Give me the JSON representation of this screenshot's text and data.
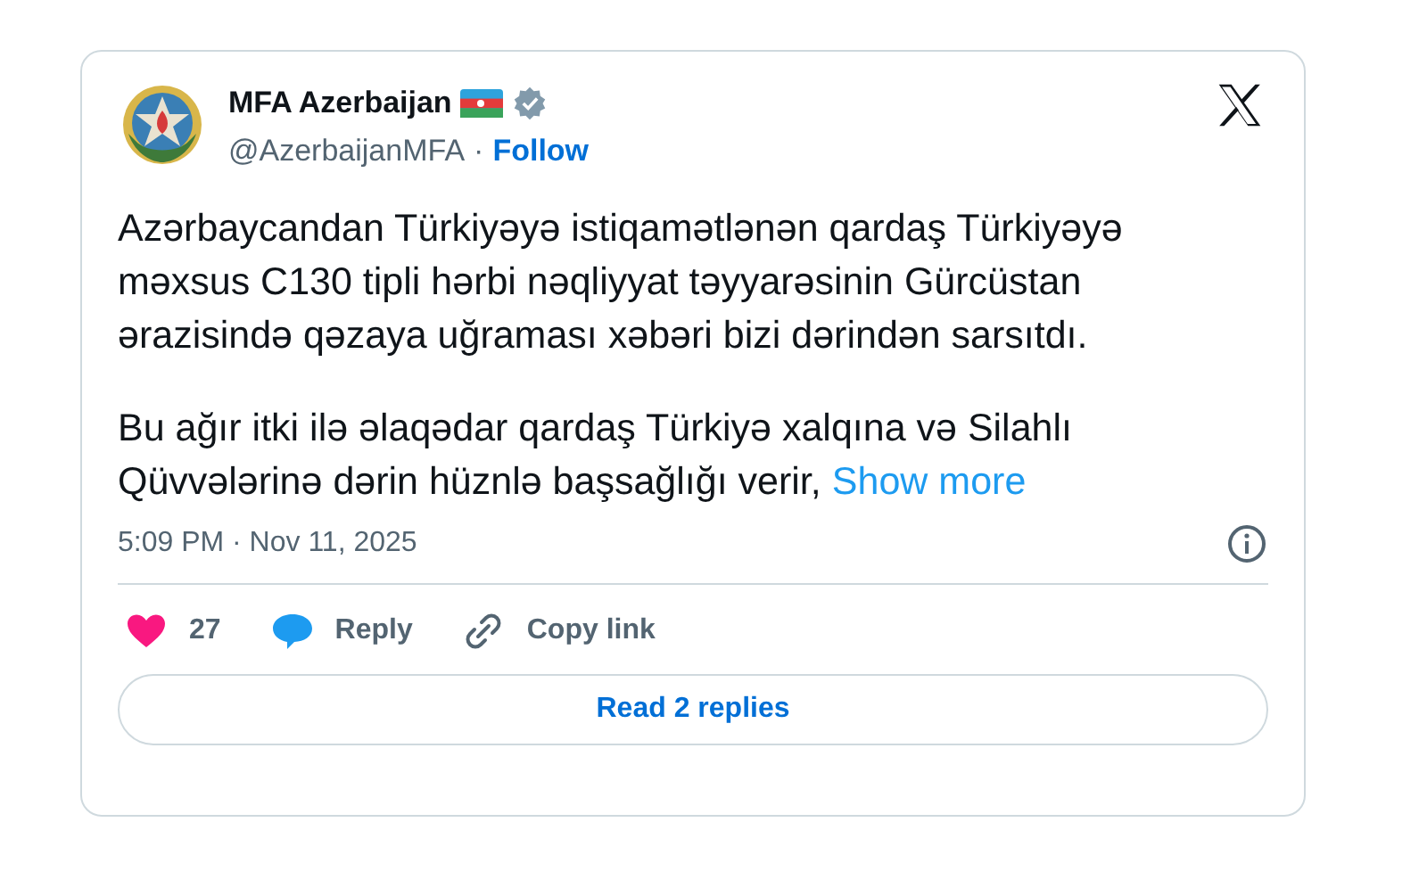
{
  "author": {
    "name": "MFA Azerbaijan",
    "handle": "@AzerbaijanMFA",
    "separator": "·",
    "follow": "Follow",
    "verified": true
  },
  "text": {
    "paragraphs": [
      "Azərbaycandan Türkiyəyə istiqamətlənən qardaş Türkiyəyə məxsus C130 tipli hərbi nəqliyyat təyyarəsinin Gürcüstan ərazisində qəzaya uğraması xəbəri bizi dərindən sarsıtdı.",
      "Bu ağır itki ilə əlaqədar qardaş Türkiyə xalqına və Silahlı Qüvvələrinə dərin hüznlə başsağlığı verir,"
    ],
    "show_more": "Show more"
  },
  "timestamp": "5:09 PM · Nov 11, 2025",
  "actions": [
    {
      "kind": "like",
      "label": "27"
    },
    {
      "kind": "reply",
      "label": "Reply"
    },
    {
      "kind": "copy",
      "label": "Copy link"
    }
  ],
  "read_replies": "Read 2 replies"
}
